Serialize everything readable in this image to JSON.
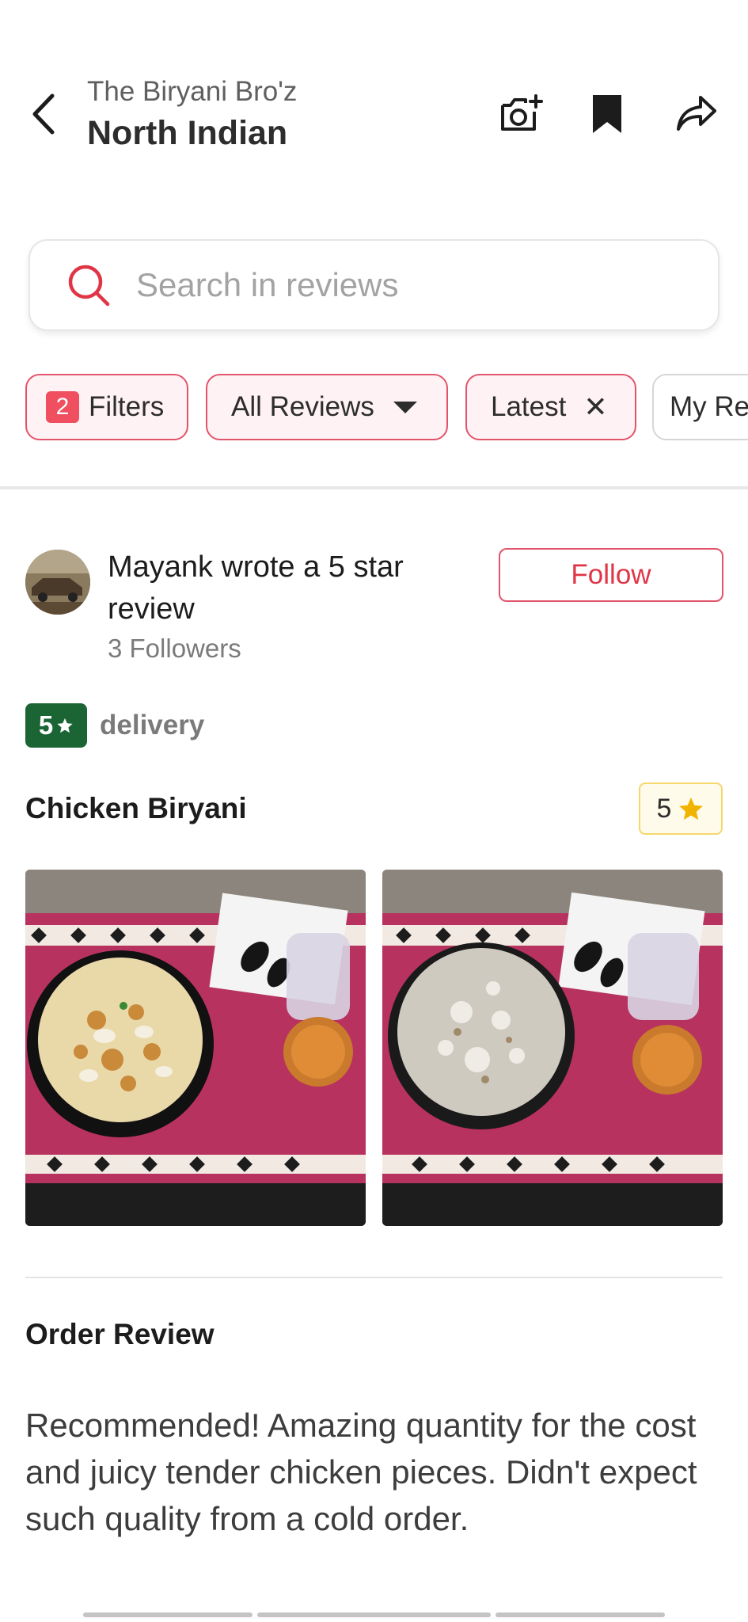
{
  "header": {
    "restaurant_name": "The Biryani Bro'z",
    "title": "North Indian",
    "icons": [
      "back-arrow-icon",
      "add-photo-icon",
      "bookmark-icon",
      "share-icon"
    ]
  },
  "search": {
    "placeholder": "Search in reviews"
  },
  "filters": {
    "count": "2",
    "filters_label": "Filters",
    "all_reviews_label": "All Reviews",
    "latest_label": "Latest",
    "my_reviews_label": "My Re"
  },
  "review": {
    "user": "Mayank",
    "title_rest": " wrote a 5 star review",
    "followers": "3 Followers",
    "follow_label": "Follow",
    "rating": "5",
    "rating_type": "delivery",
    "dish_name": "Chicken Biryani",
    "dish_rating": "5",
    "order_review_heading": "Order Review",
    "text": "Recommended! Amazing quantity for the cost and juicy tender chicken pieces. Didn't expect such quality from a cold order."
  },
  "colors": {
    "brand_red": "#e03546",
    "chip_bg": "#fff2f4",
    "rating_green": "#1b6535",
    "star_gold": "#f0b400"
  }
}
